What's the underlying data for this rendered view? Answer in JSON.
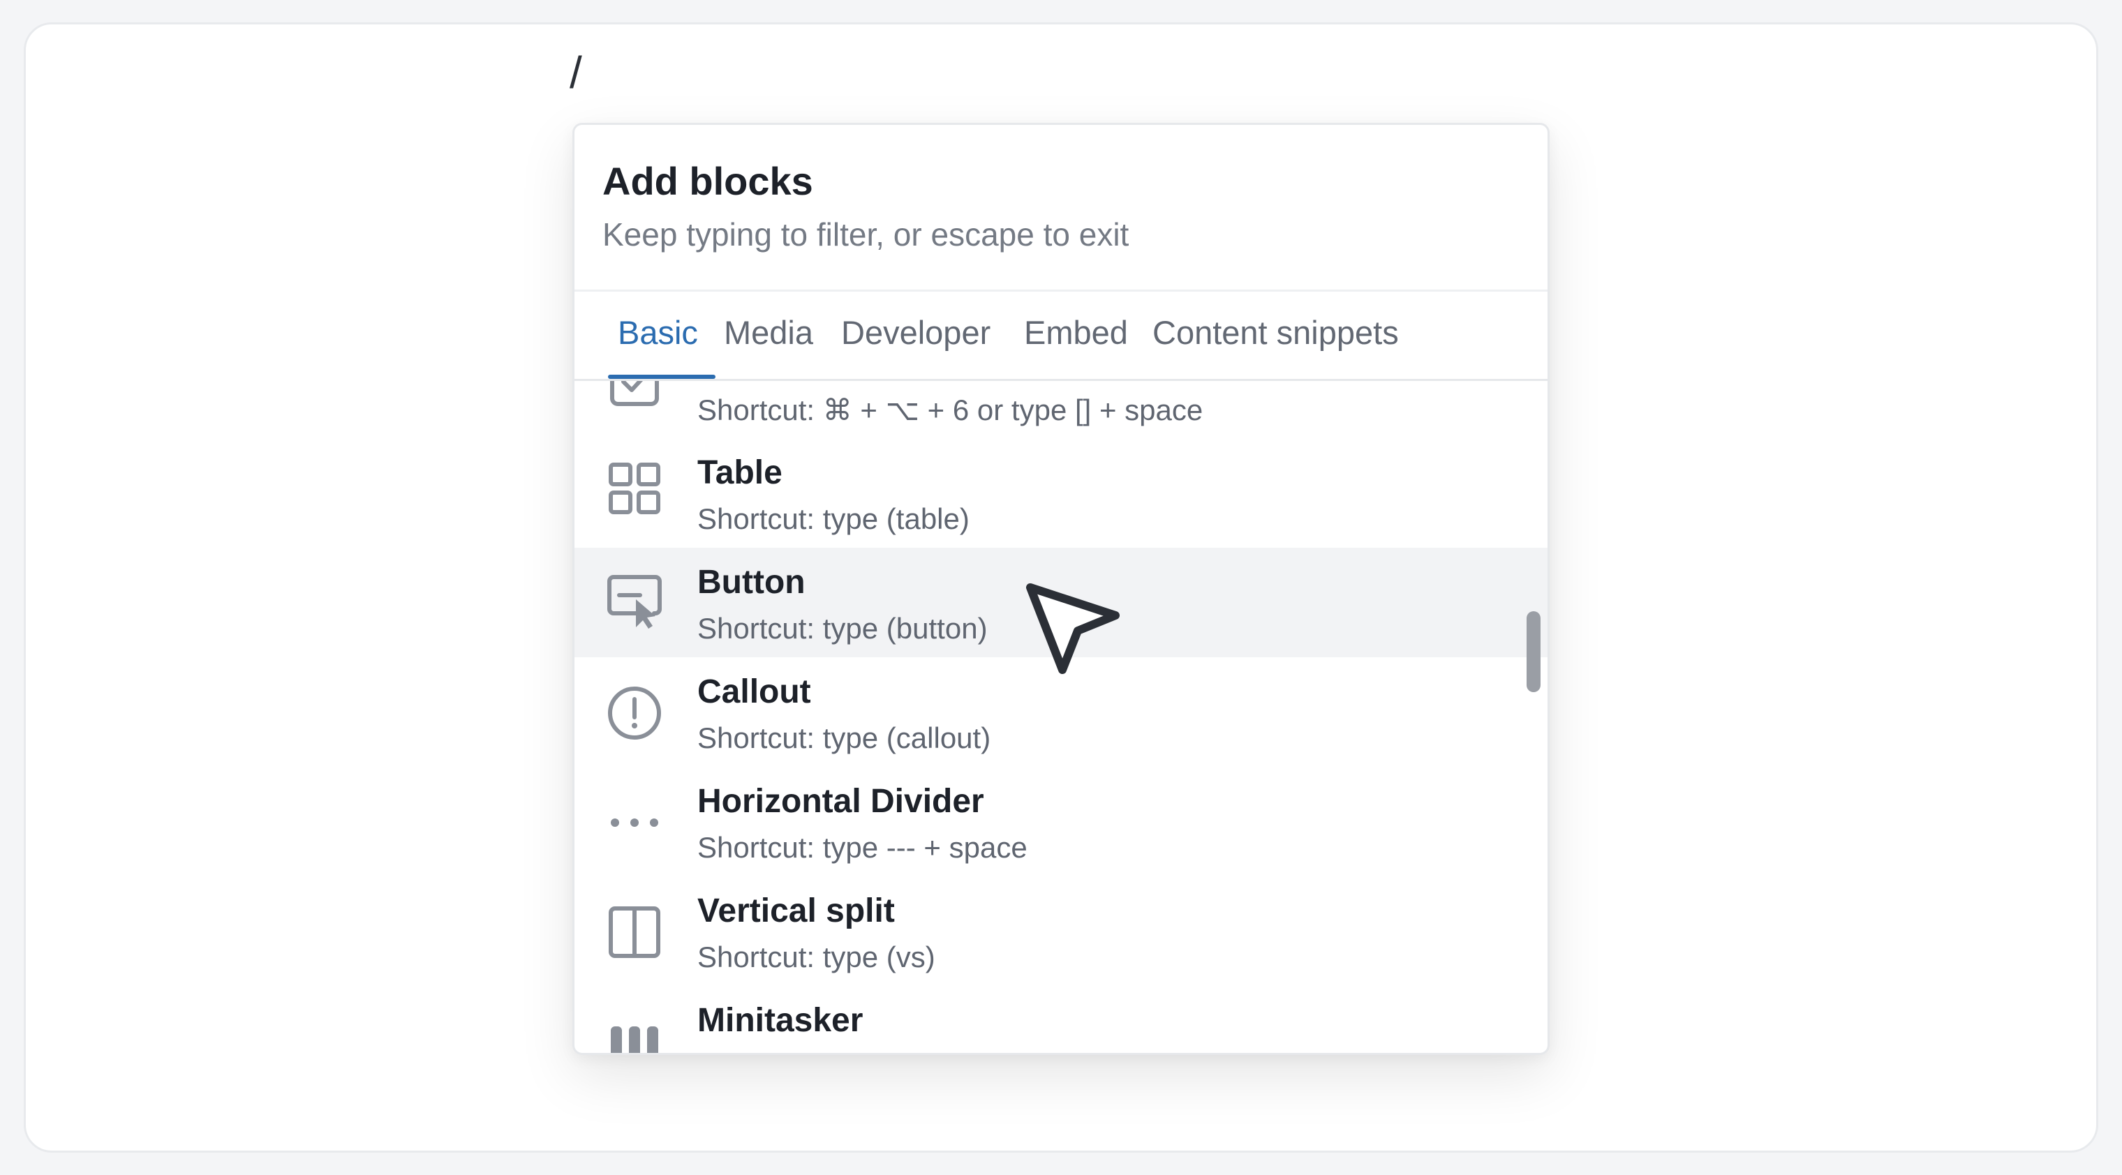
{
  "editor": {
    "slash_text": "/"
  },
  "panel": {
    "title": "Add blocks",
    "subtitle": "Keep typing to filter, or escape to exit"
  },
  "tabs": [
    {
      "label": "Basic",
      "active": true
    },
    {
      "label": "Media",
      "active": false
    },
    {
      "label": "Developer",
      "active": false
    },
    {
      "label": "Embed",
      "active": false
    },
    {
      "label": "Content snippets",
      "active": false
    }
  ],
  "items": [
    {
      "name": "",
      "shortcut": "Shortcut: ⌘ + ⌥ + 6 or type [] + space",
      "icon": "checkbox-icon"
    },
    {
      "name": "Table",
      "shortcut": "Shortcut: type (table)",
      "icon": "table-grid-icon"
    },
    {
      "name": "Button",
      "shortcut": "Shortcut: type (button)",
      "icon": "button-cursor-icon",
      "highlighted": true
    },
    {
      "name": "Callout",
      "shortcut": "Shortcut: type (callout)",
      "icon": "exclamation-circle-icon"
    },
    {
      "name": "Horizontal Divider",
      "shortcut": "Shortcut: type --- + space",
      "icon": "horizontal-dots-icon"
    },
    {
      "name": "Vertical split",
      "shortcut": "Shortcut: type (vs)",
      "icon": "vertical-split-icon"
    },
    {
      "name": "Minitasker",
      "shortcut": "",
      "icon": "minitasker-bars-icon"
    }
  ],
  "colors": {
    "accent": "#2b6cb0",
    "icon": "#8a8f98",
    "highlight_row": "#f2f3f5"
  }
}
